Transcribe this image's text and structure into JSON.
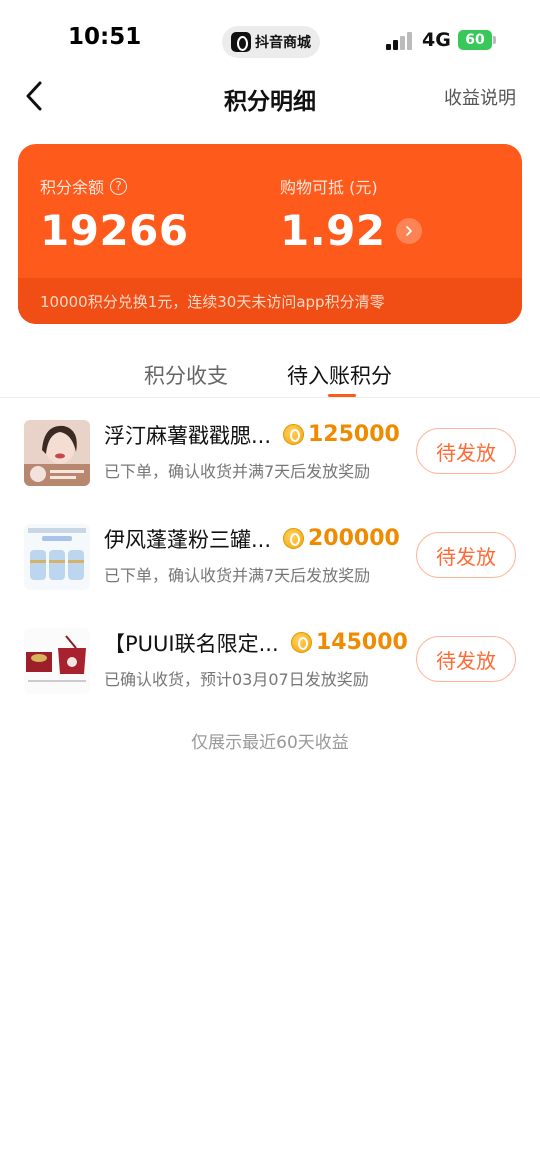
{
  "status_bar": {
    "time": "10:51",
    "app_pill": "抖音商城",
    "network": "4G",
    "battery": "60"
  },
  "nav": {
    "title": "积分明细",
    "right_link": "收益说明"
  },
  "balance_card": {
    "balance_label": "积分余额",
    "balance_value": "19266",
    "deduct_label": "购物可抵 (元)",
    "deduct_value": "1.92",
    "footer_note": "10000积分兑换1元，连续30天未访问app积分清零"
  },
  "tabs": [
    {
      "label": "积分收支",
      "active": false
    },
    {
      "label": "待入账积分",
      "active": true
    }
  ],
  "items": [
    {
      "title": "浮汀麻薯戳戳腮...",
      "points": "125000",
      "subtitle": "已下单，确认收货并满7天后发放奖励",
      "button": "待发放"
    },
    {
      "title": "伊风蓬蓬粉三罐...",
      "points": "200000",
      "subtitle": "已下单，确认收货并满7天后发放奖励",
      "button": "待发放"
    },
    {
      "title": "【PUUI联名限定...",
      "points": "145000",
      "subtitle": "已确认收货，预计03月07日发放奖励",
      "button": "待发放"
    }
  ],
  "footnote": "仅展示最近60天收益",
  "colors": {
    "accent": "#fe5a1c",
    "points": "#f08a00",
    "button_text": "#fe6a35"
  }
}
